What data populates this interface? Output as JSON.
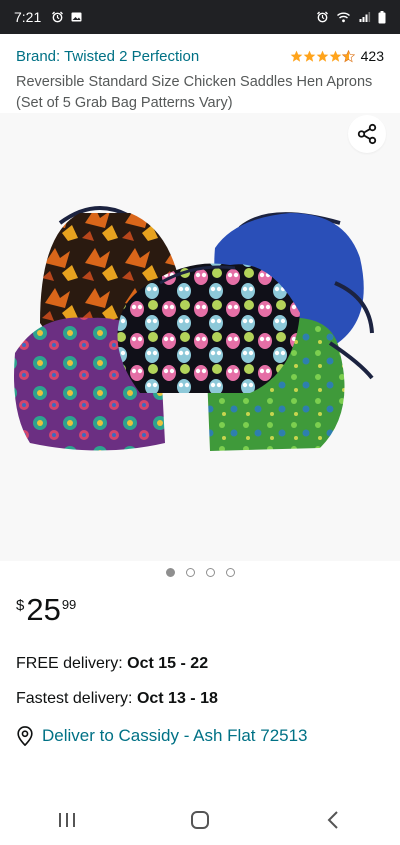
{
  "status_bar": {
    "time": "7:21",
    "left_icons": [
      "alarm-icon",
      "image-icon"
    ],
    "right_icons": [
      "alarm-icon",
      "wifi-icon",
      "signal-icon",
      "battery-icon"
    ]
  },
  "product": {
    "brand": "Brand: Twisted 2 Perfection",
    "rating_value": 4.5,
    "rating_count": "423",
    "title": "Reversible Standard Size Chicken Saddles Hen Aprons (Set of 5 Grab Bag Patterns Vary)"
  },
  "gallery": {
    "image_count": 4,
    "active_index": 0,
    "share_icon": "share-icon"
  },
  "price": {
    "symbol": "$",
    "whole": "25",
    "fraction": "99"
  },
  "delivery": {
    "free_label": "FREE delivery:",
    "free_dates": "Oct 15 - 22",
    "fast_label": "Fastest delivery:",
    "fast_dates": "Oct 13 - 18",
    "deliver_to": "Deliver to Cassidy - Ash Flat 72513",
    "location_icon": "location-pin-icon"
  },
  "nav_bar": {
    "buttons": [
      "recent-apps-icon",
      "home-icon",
      "back-icon"
    ]
  },
  "colors": {
    "link": "#007185",
    "star": "#ffa41c",
    "status_bar": "#202124"
  }
}
